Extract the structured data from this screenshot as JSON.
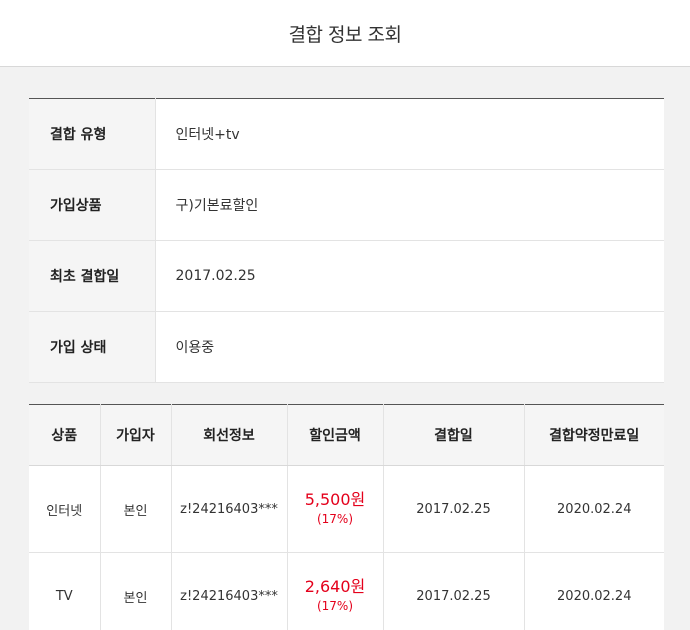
{
  "header": {
    "title": "결합 정보 조회"
  },
  "info": [
    {
      "label": "결합 유형",
      "value": "인터넷+tv"
    },
    {
      "label": "가입상품",
      "value": "구)기본료할인"
    },
    {
      "label": "최초 결합일",
      "value": "2017.02.25"
    },
    {
      "label": "가입 상태",
      "value": "이용중"
    }
  ],
  "products": {
    "headers": [
      "상품",
      "가입자",
      "회선정보",
      "할인금액",
      "결합일",
      "결합약정만료일"
    ],
    "rows": [
      {
        "product": "인터넷",
        "subscriber": "본인",
        "line": "z!24216403***",
        "amount": "5,500원",
        "rate": "(17%)",
        "join_date": "2017.02.25",
        "expire_date": "2020.02.24"
      },
      {
        "product": "TV",
        "subscriber": "본인",
        "line": "z!24216403***",
        "amount": "2,640원",
        "rate": "(17%)",
        "join_date": "2017.02.25",
        "expire_date": "2020.02.24"
      }
    ]
  },
  "colors": {
    "accent": "#e4001b",
    "header_bg": "#f5f5f5",
    "page_bg": "#f2f2f2"
  }
}
